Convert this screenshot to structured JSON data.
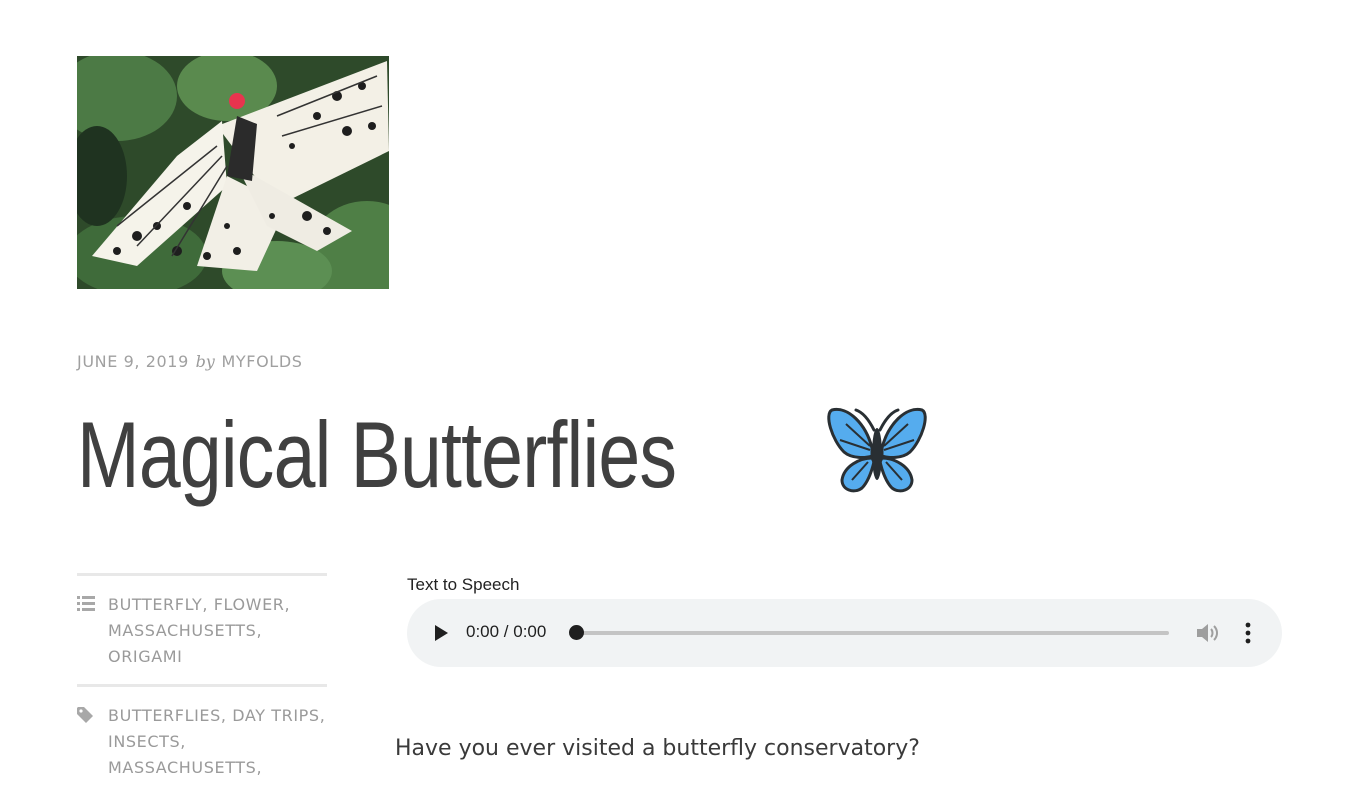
{
  "featured_image": {
    "alt": "Butterfly with black and white wings on green leaves"
  },
  "post_meta": {
    "date": "JUNE 9, 2019",
    "by": "by",
    "author": "MYFOLDS"
  },
  "post": {
    "title": "Magical Butterflies",
    "title_emoji": "butterfly-emoji",
    "intro": "Have you ever visited a butterfly conservatory?"
  },
  "categories": {
    "icon": "list-icon",
    "items": [
      "BUTTERFLY",
      "FLOWER",
      "MASSACHUSETTS",
      "ORIGAMI"
    ]
  },
  "tags": {
    "icon": "tag-icon",
    "items": [
      "BUTTERFLIES",
      "DAY TRIPS",
      "INSECTS",
      "MASSACHUSETTS"
    ]
  },
  "audio": {
    "label": "Text to Speech",
    "time": "0:00 / 0:00",
    "progress": 0
  },
  "colors": {
    "accent_blue": "#4a9fe8",
    "meta_gray": "#9a9a9a",
    "player_bg": "#f1f3f4"
  }
}
